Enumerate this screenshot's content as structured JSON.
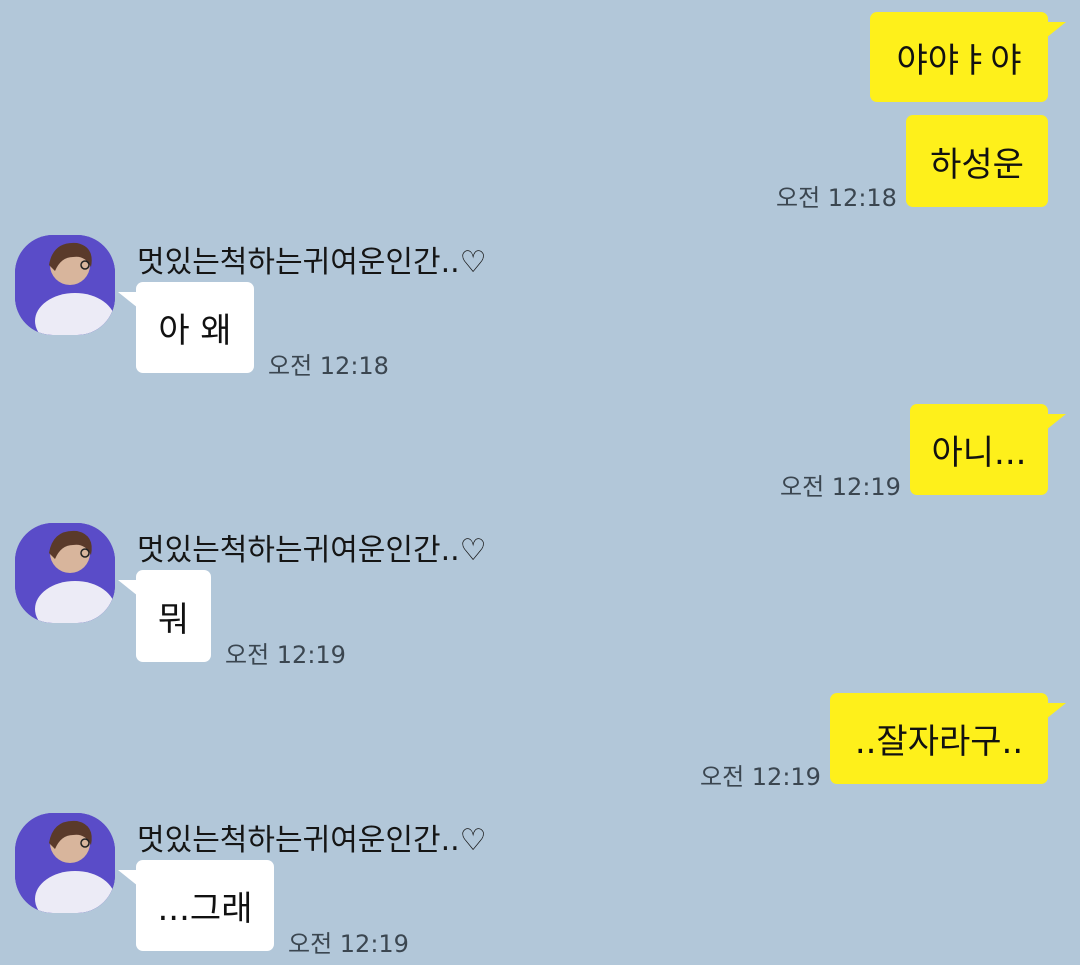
{
  "friend_name": "멋있는척하는귀여운인간..♡",
  "messages": [
    {
      "text": "야야ㅑ야",
      "time": ""
    },
    {
      "text": "하성운",
      "time": "오전 12:18"
    },
    {
      "text": "아 왜",
      "time": "오전 12:18"
    },
    {
      "text": "아니...",
      "time": "오전 12:19"
    },
    {
      "text": "뭐",
      "time": "오전 12:19"
    },
    {
      "text": "..잘자라구..",
      "time": "오전 12:19"
    },
    {
      "text": "...그래",
      "time": "오전 12:19"
    }
  ],
  "colors": {
    "background": "#b2c7d9",
    "my_bubble": "#fef01b",
    "friend_bubble": "#ffffff"
  }
}
